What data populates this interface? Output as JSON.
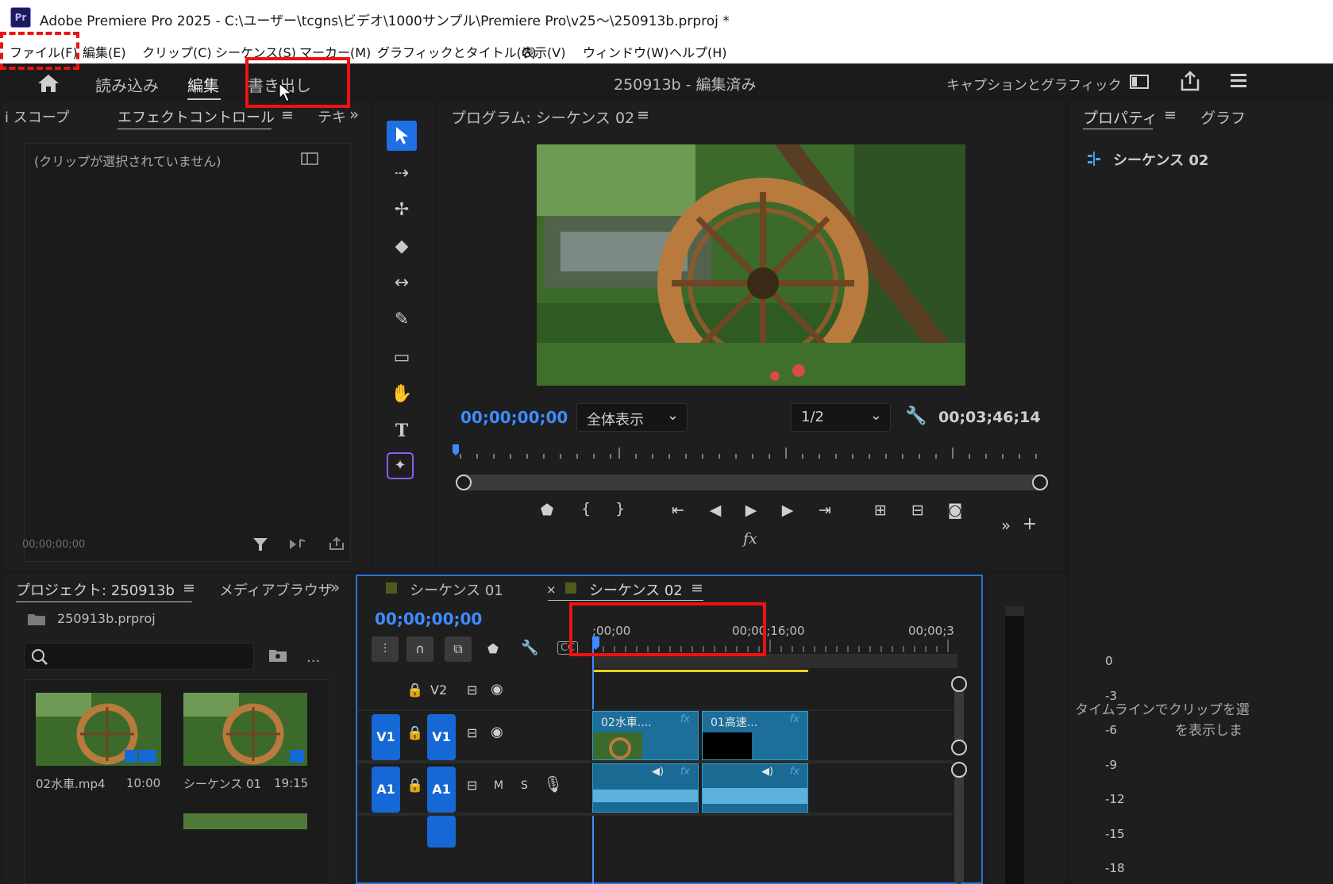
{
  "window": {
    "app_icon": "Pr",
    "title": "Adobe Premiere Pro 2025 - C:\\ユーザー\\tcgns\\ビデオ\\1000サンプル\\Premiere Pro\\v25～\\250913b.prproj *"
  },
  "menu": [
    "ファイル(F)",
    "編集(E)",
    "クリップ(C)",
    "シーケンス(S)",
    "マーカー(M)",
    "グラフィックとタイトル(G)",
    "表示(V)",
    "ウィンドウ(W)",
    "ヘルプ(H)"
  ],
  "appbar": {
    "tabs": [
      "読み込み",
      "編集",
      "書き出し"
    ],
    "active_tab": "編集",
    "project_status": "250913b - 編集済み",
    "workspace": "キャプションとグラフィック"
  },
  "effects_panel": {
    "tabs": [
      "i スコープ",
      "エフェクトコントロール",
      "テキ"
    ],
    "empty_message": "(クリップが選択されていません)",
    "timecode": "00;00;00;00"
  },
  "program_monitor": {
    "title": "プログラム: シーケンス 02",
    "current_time": "00;00;00;00",
    "zoom": "全体表示",
    "resolution": "1/2",
    "duration": "00;03;46;14",
    "fx_label": "fx"
  },
  "properties_panel": {
    "tabs": [
      "プロパティ",
      "グラフ"
    ],
    "sequence": "シーケンス 02",
    "hint_line1": "タイムラインでクリップを選",
    "hint_line2": "を表示しま"
  },
  "project_panel": {
    "tabs": [
      "プロジェクト: 250913b",
      "メディアブラウザ"
    ],
    "file": "250913b.prproj",
    "search_placeholder": "",
    "more": "...",
    "items": [
      {
        "name": "02水車.mp4",
        "duration": "10:00"
      },
      {
        "name": "シーケンス 01",
        "duration": "19:15"
      }
    ]
  },
  "timeline": {
    "tabs": [
      "シーケンス 01",
      "シーケンス 02"
    ],
    "close": "×",
    "current_time": "00;00;00;00",
    "ruler": [
      ";00;00",
      "00;00;16;00",
      "00;00;3"
    ],
    "tracks": {
      "v2": "V2",
      "v1": "V1",
      "a1": "A1",
      "mute": "M",
      "solo": "S"
    },
    "clips": [
      "02水車....",
      "01高速..."
    ],
    "fx": "fx"
  },
  "audio_meter": {
    "labels": [
      "0",
      "-3",
      "-6",
      "-9",
      "-12",
      "-15",
      "-18"
    ]
  },
  "colors": {
    "accent": "#3d8cff",
    "annotation_red": "#e11111",
    "clip_blue": "#1d6f9a",
    "track_button": "#1668d6"
  }
}
